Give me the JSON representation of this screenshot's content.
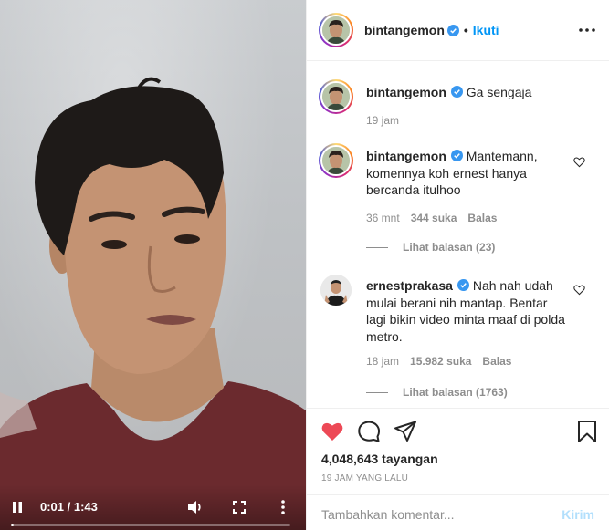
{
  "video": {
    "time": "0:01 / 1:43",
    "progress": 0.01
  },
  "header": {
    "username": "bintangemon",
    "separator": "•",
    "follow_label": "Ikuti"
  },
  "caption": {
    "username": "bintangemon",
    "text": "Ga sengaja",
    "time": "19 jam"
  },
  "comments": [
    {
      "username": "bintangemon",
      "text": "Mantemann, komennya koh ernest hanya bercanda itulhoo",
      "time": "36 mnt",
      "likes": "344 suka",
      "reply_label": "Balas",
      "view_replies": "Lihat balasan (23)"
    },
    {
      "username": "ernestprakasa",
      "text": "Nah nah udah mulai berani nih mantap. Bentar lagi bikin video minta maaf di polda metro.",
      "time": "18 jam",
      "likes": "15.982 suka",
      "reply_label": "Balas",
      "view_replies": "Lihat balasan (1763)"
    }
  ],
  "stats": {
    "views": "4,048,643 tayangan",
    "time_ago": "19 JAM YANG LALU"
  },
  "add_comment": {
    "placeholder": "Tambahkan komentar...",
    "post_label": "Kirim"
  },
  "colors": {
    "accent": "#0095f6",
    "liked": "#ed4956",
    "muted": "#8e8e8e"
  }
}
